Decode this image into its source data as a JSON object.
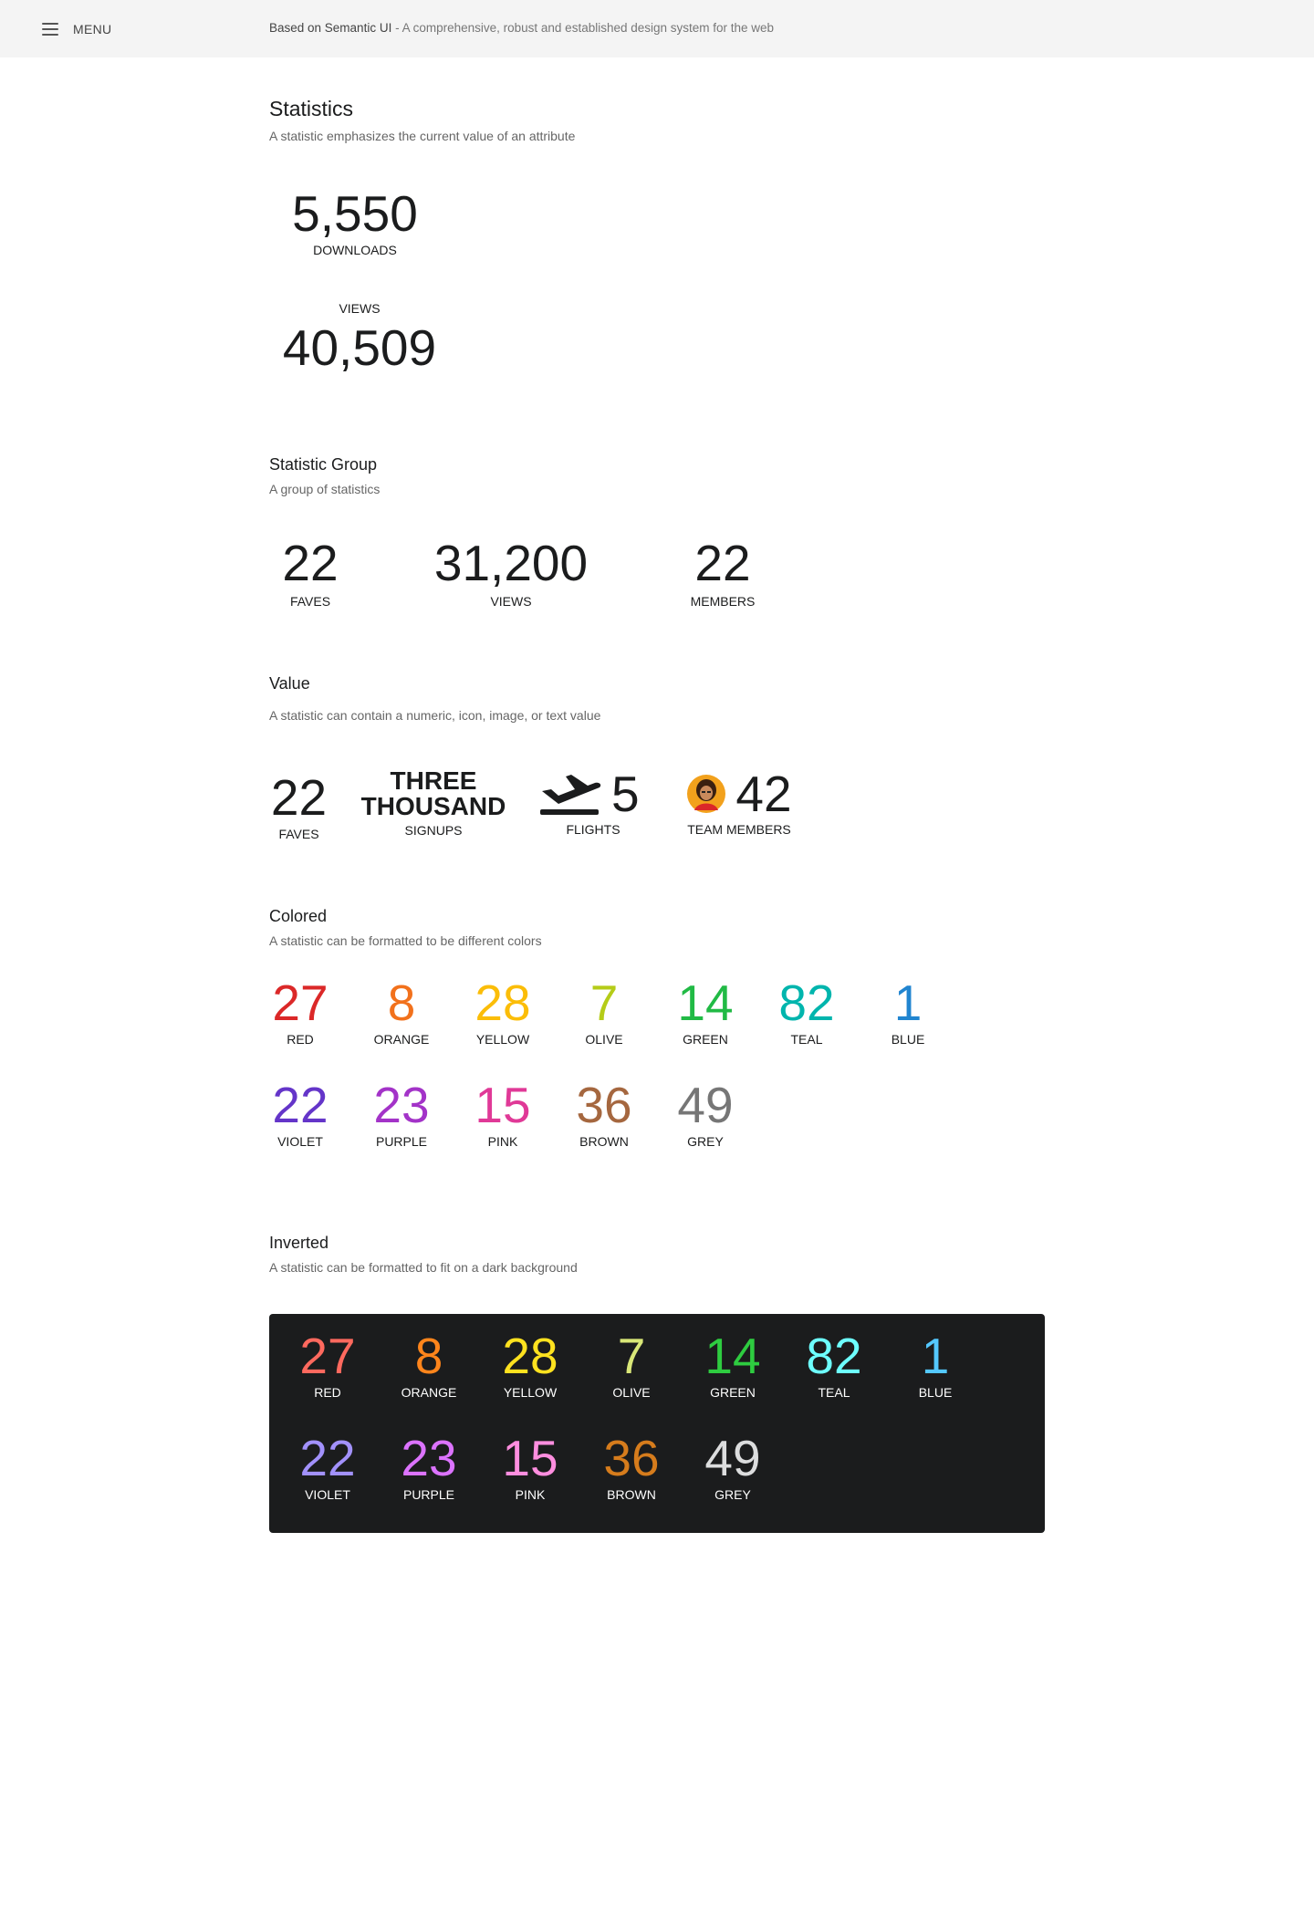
{
  "topbar": {
    "menu_label": "MENU",
    "tagline_strong": "Based on Semantic UI",
    "tagline_rest": " - A comprehensive, robust and established design system for the web"
  },
  "statistics": {
    "title": "Statistics",
    "desc": "A statistic emphasizes the current value of an attribute",
    "downloads": {
      "value": "5,550",
      "label": "DOWNLOADS"
    },
    "views": {
      "value": "40,509",
      "label": "VIEWS"
    }
  },
  "group": {
    "title": "Statistic Group",
    "desc": "A group of statistics",
    "items": [
      {
        "value": "22",
        "label": "FAVES"
      },
      {
        "value": "31,200",
        "label": "VIEWS"
      },
      {
        "value": "22",
        "label": "MEMBERS"
      }
    ]
  },
  "value_section": {
    "title": "Value",
    "desc": "A statistic can contain a numeric, icon, image, or text value",
    "faves": {
      "value": "22",
      "label": "FAVES"
    },
    "signups": {
      "value_line1": "THREE",
      "value_line2": "THOUSAND",
      "label": "SIGNUPS"
    },
    "flights": {
      "icon": "plane-icon",
      "value": "5",
      "label": "FLIGHTS"
    },
    "team": {
      "icon": "avatar",
      "value": "42",
      "label": "TEAM MEMBERS"
    }
  },
  "colored": {
    "title": "Colored",
    "desc": "A statistic can be formatted to be different colors",
    "items": [
      {
        "value": "27",
        "label": "RED",
        "color": "#db2828"
      },
      {
        "value": "8",
        "label": "ORANGE",
        "color": "#f2711c"
      },
      {
        "value": "28",
        "label": "YELLOW",
        "color": "#fbbd08"
      },
      {
        "value": "7",
        "label": "OLIVE",
        "color": "#b5cc18"
      },
      {
        "value": "14",
        "label": "GREEN",
        "color": "#21ba45"
      },
      {
        "value": "82",
        "label": "TEAL",
        "color": "#00b5ad"
      },
      {
        "value": "1",
        "label": "BLUE",
        "color": "#2185d0"
      },
      {
        "value": "22",
        "label": "VIOLET",
        "color": "#6435c9"
      },
      {
        "value": "23",
        "label": "PURPLE",
        "color": "#a333c8"
      },
      {
        "value": "15",
        "label": "PINK",
        "color": "#e03997"
      },
      {
        "value": "36",
        "label": "BROWN",
        "color": "#a5673f"
      },
      {
        "value": "49",
        "label": "GREY",
        "color": "#767676"
      }
    ]
  },
  "inverted": {
    "title": "Inverted",
    "desc": "A statistic can be formatted to fit on a dark background",
    "items": [
      {
        "value": "27",
        "label": "RED",
        "color": "#ff695e"
      },
      {
        "value": "8",
        "label": "ORANGE",
        "color": "#ff851b"
      },
      {
        "value": "28",
        "label": "YELLOW",
        "color": "#ffe21f"
      },
      {
        "value": "7",
        "label": "OLIVE",
        "color": "#d9e778"
      },
      {
        "value": "14",
        "label": "GREEN",
        "color": "#2ecc40"
      },
      {
        "value": "82",
        "label": "TEAL",
        "color": "#6dffff"
      },
      {
        "value": "1",
        "label": "BLUE",
        "color": "#54c8ff"
      },
      {
        "value": "22",
        "label": "VIOLET",
        "color": "#a291fb"
      },
      {
        "value": "23",
        "label": "PURPLE",
        "color": "#dc73ff"
      },
      {
        "value": "15",
        "label": "PINK",
        "color": "#ff8edf"
      },
      {
        "value": "36",
        "label": "BROWN",
        "color": "#d67c1c"
      },
      {
        "value": "49",
        "label": "GREY",
        "color": "#dcddde"
      }
    ]
  }
}
